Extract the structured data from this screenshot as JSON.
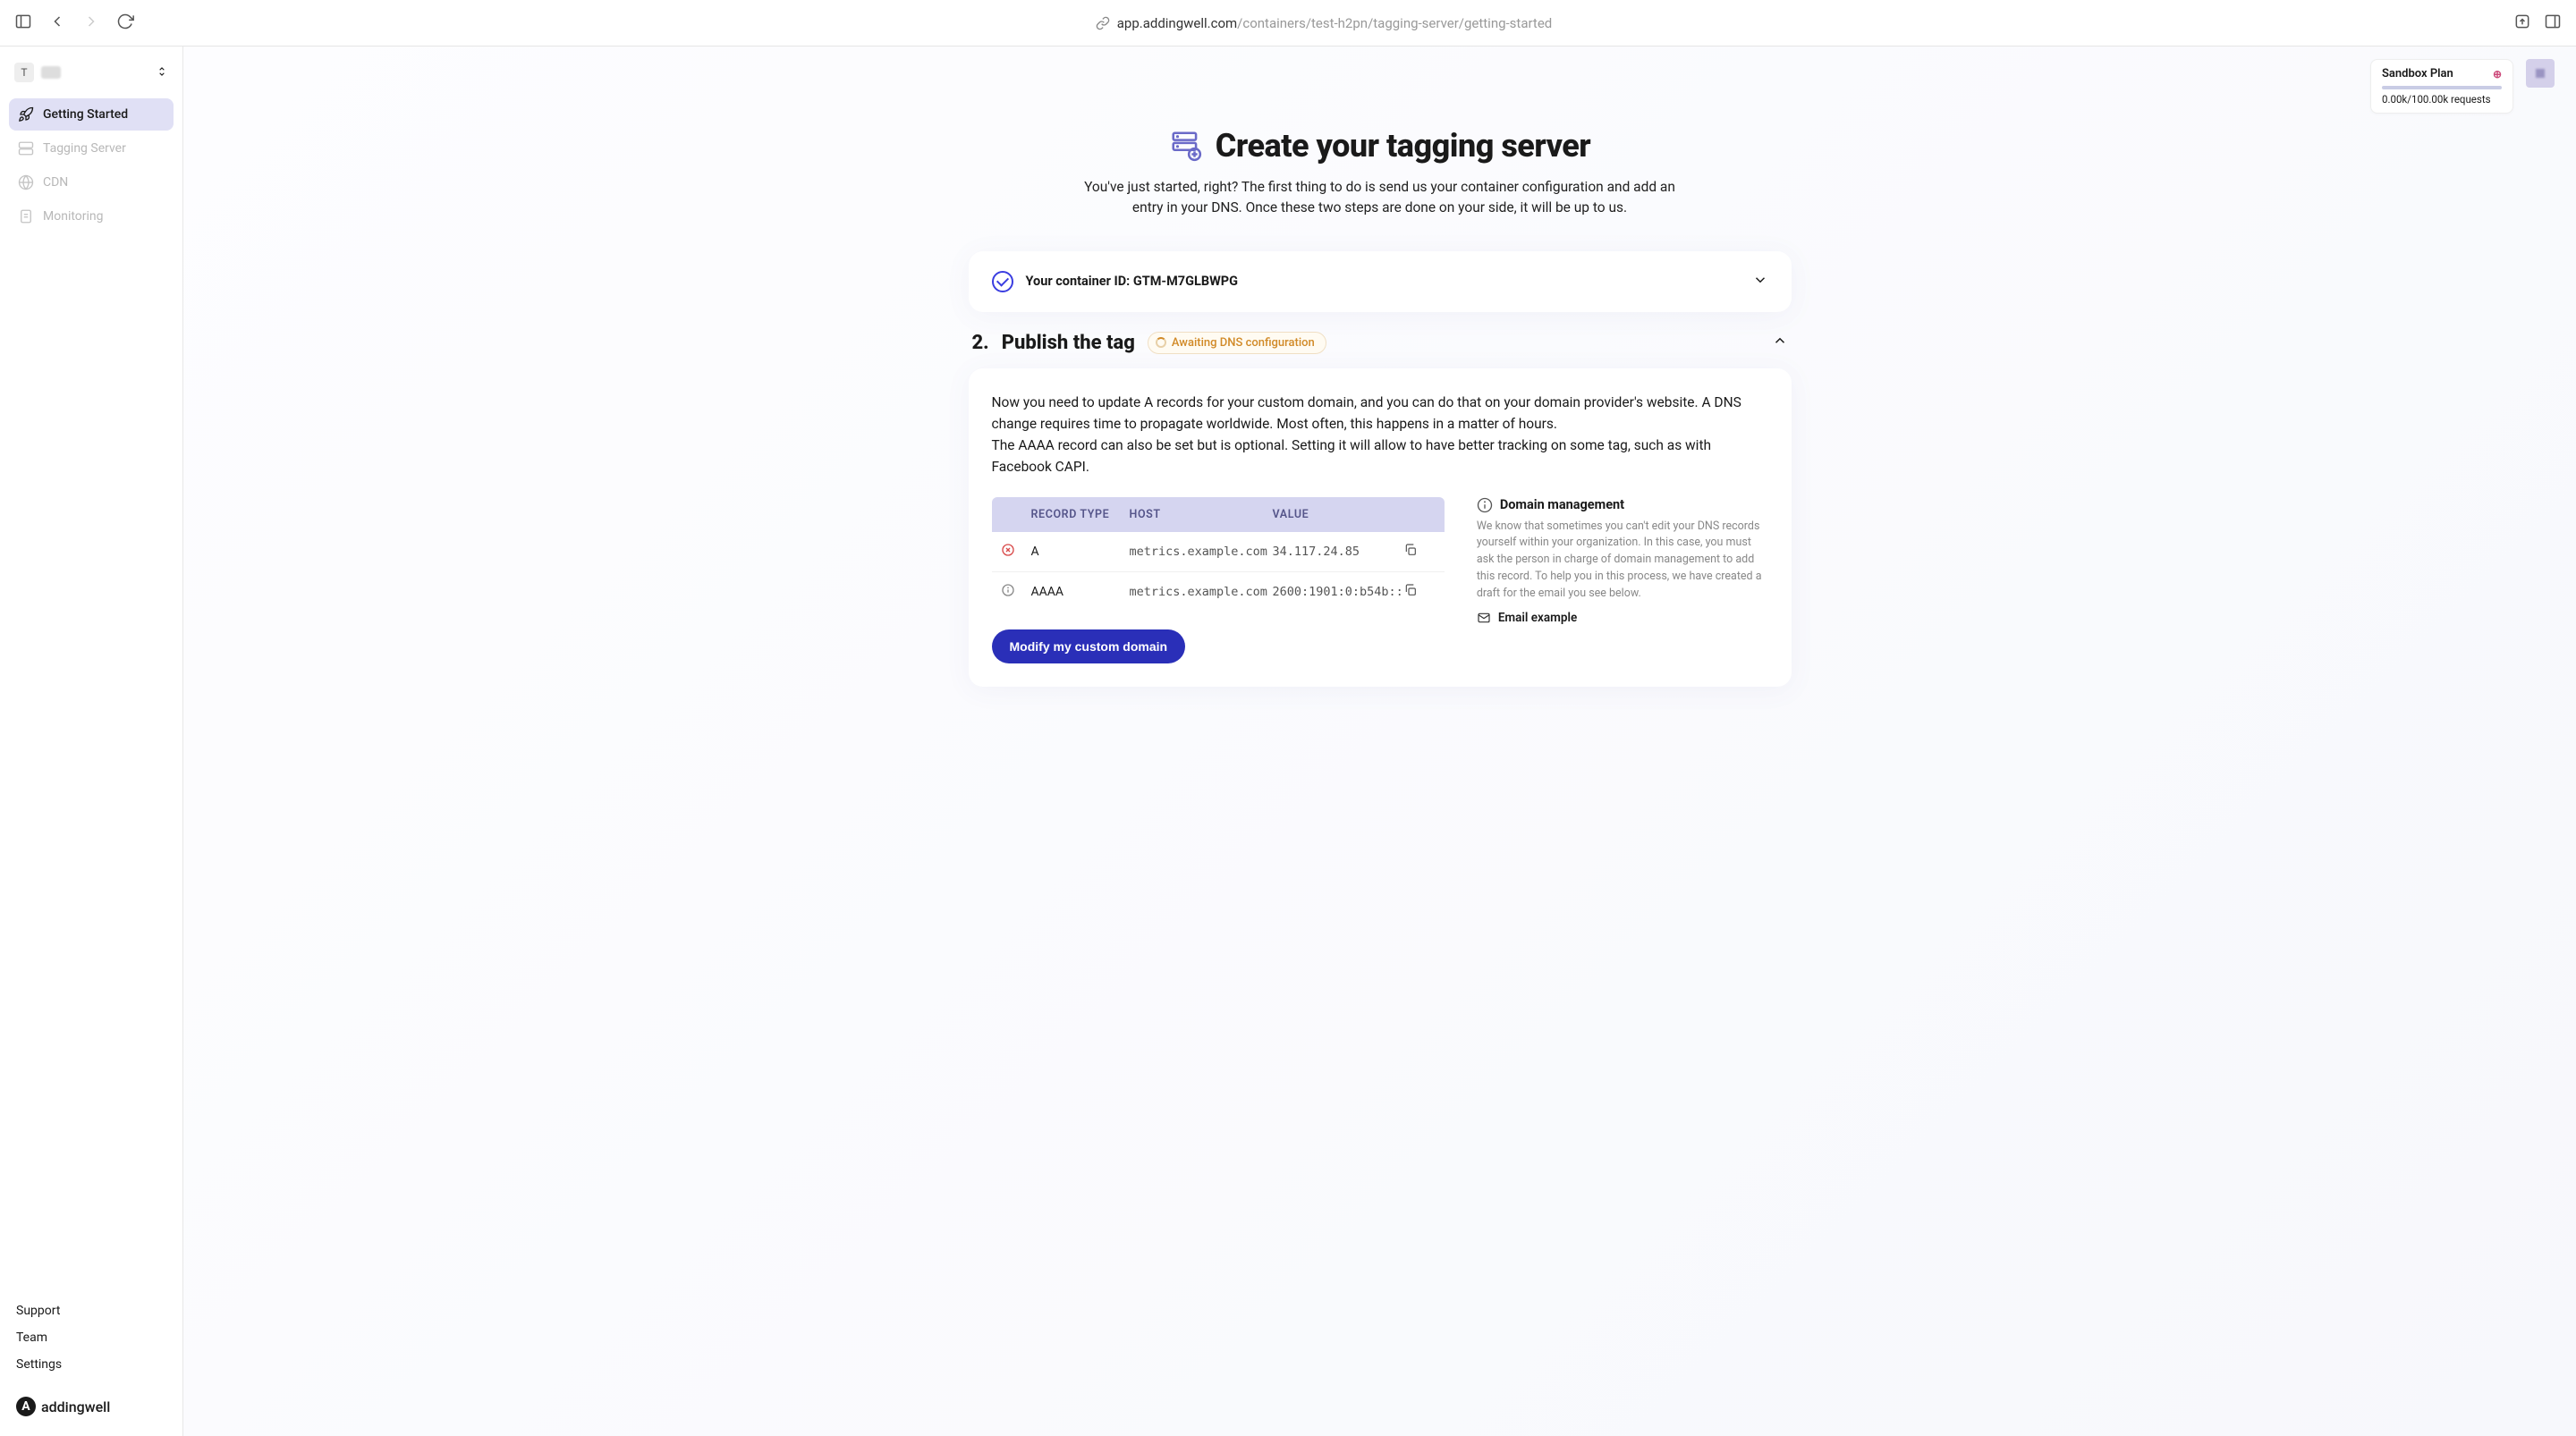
{
  "browser": {
    "host": "app.addingwell.com",
    "path": "/containers/test-h2pn/tagging-server/getting-started"
  },
  "project": {
    "initial": "T"
  },
  "sidebar": {
    "items": [
      {
        "label": "Getting Started"
      },
      {
        "label": "Tagging Server"
      },
      {
        "label": "CDN"
      },
      {
        "label": "Monitoring"
      }
    ],
    "bottom": {
      "support": "Support",
      "team": "Team",
      "settings": "Settings"
    }
  },
  "brand": "addingwell",
  "plan": {
    "name": "Sandbox Plan",
    "upgrade": "⊕",
    "usage": "0.00k/100.00k requests"
  },
  "hero": {
    "title": "Create your tagging server",
    "subtitle": "You've just started, right? The first thing to do is send us your container configuration and add an entry in your DNS. Once these two steps are done on your side, it will be up to us."
  },
  "step1": {
    "label": "Your container ID: GTM-M7GLBWPG"
  },
  "step2": {
    "num": "2.",
    "title": "Publish the tag",
    "status": "Awaiting DNS configuration",
    "desc1": "Now you need to update A records for your custom domain, and you can do that on your domain provider's website. A DNS change requires time to propagate worldwide. Most often, this happens in a matter of hours.",
    "desc2": "The AAAA record can also be set but is optional. Setting it will allow to have better tracking on some tag, such as with Facebook CAPI.",
    "table": {
      "headers": {
        "type": "RECORD TYPE",
        "host": "HOST",
        "value": "VALUE"
      },
      "rows": [
        {
          "type": "A",
          "host": "metrics.example.com",
          "value": "34.117.24.85",
          "status": "error"
        },
        {
          "type": "AAAA",
          "host": "metrics.example.com",
          "value": "2600:1901:0:b54b::",
          "status": "info"
        }
      ]
    },
    "modify_btn": "Modify my custom domain",
    "info": {
      "title": "Domain management",
      "text": "We know that sometimes you can't edit your DNS records yourself within your organization. In this case, you must ask the person in charge of domain management to add this record. To help you in this process, we have created a draft for the email you see below.",
      "email_link": "Email example"
    }
  }
}
